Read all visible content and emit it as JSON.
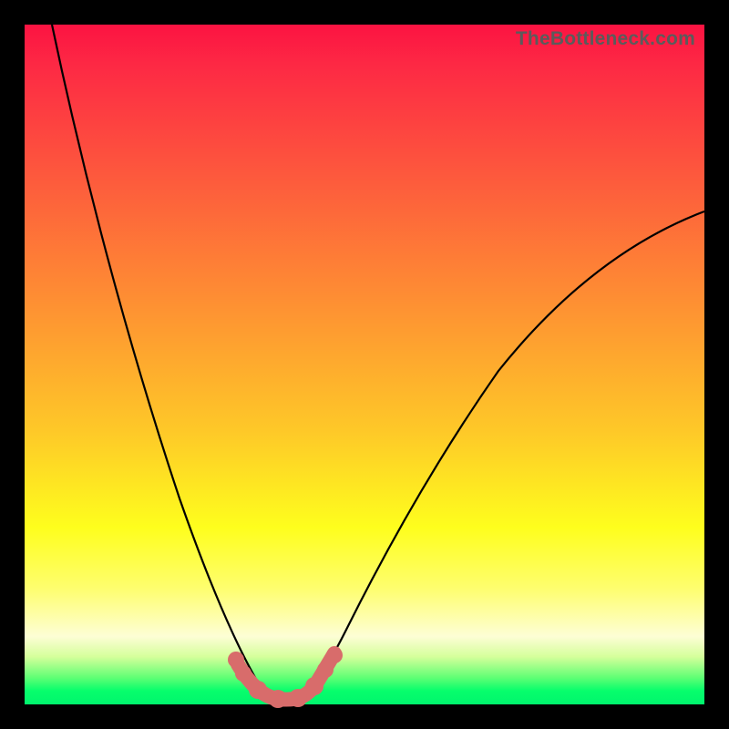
{
  "watermark": "TheBottleneck.com",
  "colors": {
    "frame": "#000000",
    "gradient_top": "#fc1342",
    "gradient_mid": "#fefe1d",
    "gradient_bottom": "#00f56d",
    "curve": "#000000",
    "marker": "#d86c6b"
  },
  "chart_data": {
    "type": "line",
    "title": "",
    "xlabel": "",
    "ylabel": "",
    "xlim": [
      0,
      100
    ],
    "ylim": [
      0,
      100
    ],
    "grid": false,
    "legend": false,
    "series": [
      {
        "name": "left-curve",
        "x": [
          4,
          8,
          12,
          16,
          20,
          24,
          28,
          31,
          33,
          35,
          36.5
        ],
        "y": [
          100,
          82,
          64,
          47,
          32,
          20,
          10,
          4.5,
          2.2,
          0.9,
          0.3
        ]
      },
      {
        "name": "right-curve",
        "x": [
          40,
          42,
          45,
          50,
          56,
          63,
          71,
          80,
          90,
          100
        ],
        "y": [
          0.3,
          1.8,
          5,
          12,
          22,
          34,
          46,
          57,
          66,
          72
        ]
      },
      {
        "name": "valley-band",
        "x": [
          31,
          33,
          35,
          37,
          39,
          41,
          43,
          45
        ],
        "y": [
          5.5,
          2.5,
          0.9,
          0.3,
          0.3,
          0.9,
          2.5,
          5.5
        ]
      }
    ],
    "annotations": [
      {
        "text": "TheBottleneck.com",
        "position": "top-right"
      }
    ]
  }
}
